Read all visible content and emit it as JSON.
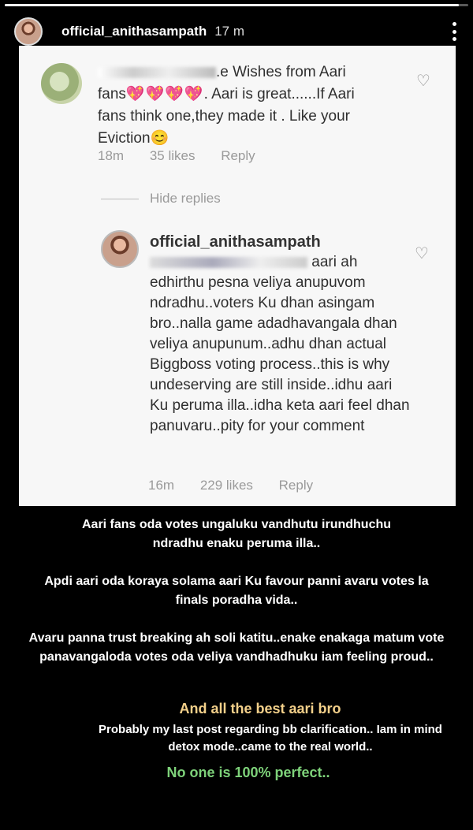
{
  "progress": {
    "fraction": 0.98
  },
  "header": {
    "username": "official_anithasampath",
    "time": "17 m",
    "more_icon": "more-vertical-icon"
  },
  "comment1": {
    "text_a": ".e Wishes from Aari",
    "text_b": "fans",
    "hearts": "💖💖💖💖",
    "text_c": ". Aari is great......If Aari\nfans think one,they made it . Like your\nEviction",
    "emoji": "😊",
    "time": "18m",
    "likes": "35 likes",
    "reply": "Reply"
  },
  "hide_replies": "Hide replies",
  "comment2": {
    "username": "official_anithasampath",
    "mention_tail": "aari",
    "body": "ah edhirthu pesna veliya anupuvom ndradhu..voters Ku dhan asingam bro..nalla game adadhavangala dhan veliya anupunum..adhu dhan actual Biggboss voting process..this is why undeserving are still inside..idhu aari Ku peruma illa..idha keta aari feel dhan panuvaru..pity for your comment",
    "time": "16m",
    "likes": "229 likes",
    "reply": "Reply"
  },
  "captions": {
    "c1": "Aari fans oda votes ungaluku vandhutu irundhuchu ndradhu enaku peruma illa..",
    "c2": "Apdi aari oda koraya solama aari Ku favour panni avaru votes la finals poradha vida..",
    "c3": "Avaru panna trust breaking ah soli katitu..enake enakaga matum vote panavangaloda votes oda veliya vandhadhuku iam feeling proud..",
    "c4": "And all the best aari bro",
    "c5": "Probably my last post regarding bb clarification.. Iam in mind detox mode..came to the real world..",
    "c6": "No one is 100% perfect.."
  },
  "colors": {
    "best_wishes": "#f3d08a",
    "perfect": "#7ed27a",
    "hearts": "#e0457b"
  }
}
